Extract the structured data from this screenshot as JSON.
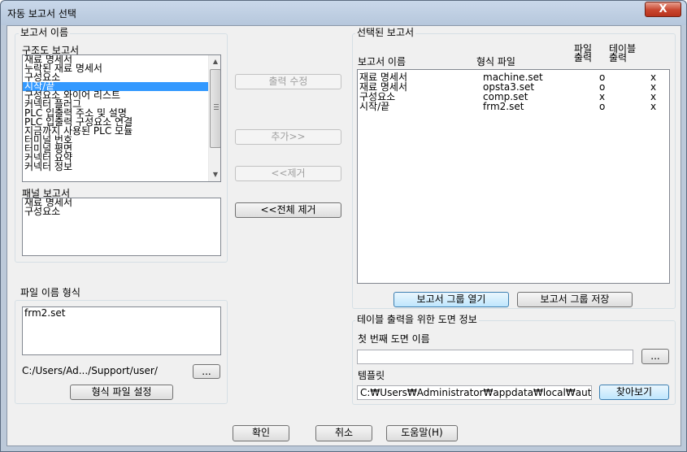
{
  "window": {
    "title": "자동 보고서 선택",
    "close_label": "X"
  },
  "report_names": {
    "group_label": "보고서 이름",
    "schematic_label": "구조도 보고서",
    "schematic_items": [
      {
        "label": "재료 명세서",
        "selected": false
      },
      {
        "label": "누락된 재료 명세서",
        "selected": false
      },
      {
        "label": "구성요소",
        "selected": false
      },
      {
        "label": "시작/끝",
        "selected": true
      },
      {
        "label": "구성요소 와이어 리스트",
        "selected": false
      },
      {
        "label": "커넥터 플러그",
        "selected": false
      },
      {
        "label": "PLC 입출력 주소 및 설명",
        "selected": false
      },
      {
        "label": "PLC 입출력 구성요소 연결",
        "selected": false
      },
      {
        "label": "지금까지 사용된 PLC 모듈",
        "selected": false
      },
      {
        "label": "터미널 번호",
        "selected": false
      },
      {
        "label": "터미널 평면",
        "selected": false
      },
      {
        "label": "커넥터 요약",
        "selected": false
      },
      {
        "label": "커넥터 정보",
        "selected": false
      }
    ],
    "panel_label": "패널 보고서",
    "panel_items": [
      "재료 명세서",
      "구성요소"
    ]
  },
  "middle_buttons": {
    "modify_output": "출력 수정",
    "add": "추가>>",
    "remove": "<<제거",
    "remove_all": "<<전체 제거"
  },
  "selected_reports": {
    "group_label": "선택된 보고서",
    "columns": {
      "report_name": "보고서 이름",
      "format_file": "형식 파일",
      "file_output_line1": "파일",
      "file_output_line2": "출력",
      "table_output_line1": "테이블",
      "table_output_line2": "출력"
    },
    "rows": [
      {
        "name": "재료 명세서",
        "format": "machine.set",
        "file": "o",
        "table": "x"
      },
      {
        "name": "재료 명세서",
        "format": "opsta3.set",
        "file": "o",
        "table": "x"
      },
      {
        "name": "구성요소",
        "format": "comp.set",
        "file": "x",
        "table": "x"
      },
      {
        "name": "시작/끝",
        "format": "frm2.set",
        "file": "o",
        "table": "x"
      }
    ],
    "open_group": "보고서 그룹 열기",
    "save_group": "보고서 그룹 저장"
  },
  "file_name_format": {
    "group_label": "파일 이름 형식",
    "value": "frm2.set",
    "path": "C:/Users/Ad.../Support/user/",
    "browse": "...",
    "set_format_file": "형식 파일 설정"
  },
  "table_output": {
    "group_label": "테이블 출력을 위한 도면 정보",
    "first_drawing_label": "첫 번째 도면 이름",
    "first_drawing_value": "",
    "browse": "...",
    "template_label": "템플릿",
    "template_value": "C:₩Users₩Administrator₩appdata₩local₩autode",
    "template_browse": "찾아보기"
  },
  "footer": {
    "ok": "확인",
    "cancel": "취소",
    "help": "도움말(H)"
  }
}
